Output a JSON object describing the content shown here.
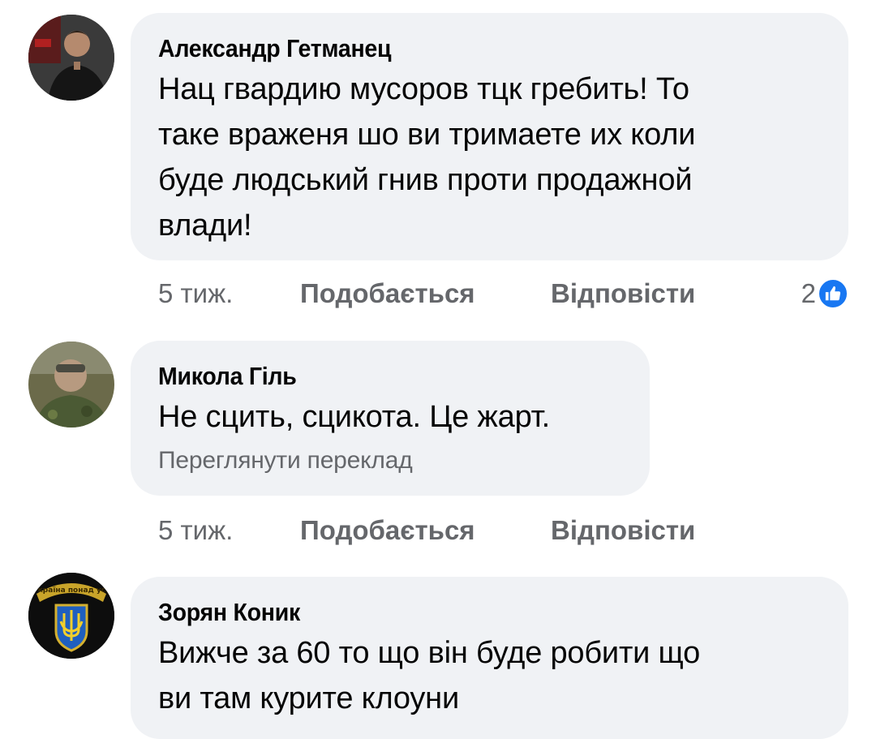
{
  "comments": [
    {
      "author": "Александр Гетманец",
      "text_lines": [
        "Нац гвардию мусоров тцк гребить! То",
        "таке враженя шо ви тримаете их коли",
        "буде людський гнив проти продажной",
        "влади!"
      ],
      "time": "5 тиж.",
      "like_label": "Подобається",
      "reply_label": "Відповісти",
      "reaction_count": "2",
      "reaction_icon": "like-icon",
      "avatar_icon": "user-photo"
    },
    {
      "author": "Микола Гіль",
      "text_lines": [
        "Не сцить, сцикота. Це жарт."
      ],
      "translate_label": "Переглянути переклад",
      "time": "5 тиж.",
      "like_label": "Подобається",
      "reply_label": "Відповісти",
      "avatar_icon": "user-photo"
    },
    {
      "author": "Зорян Коник",
      "text_lines": [
        "Вижче за 60 то що він буде робити що",
        "ви там курите клоуни"
      ],
      "avatar_icon": "trident-emblem",
      "avatar_caption": "Україна понад усе"
    }
  ],
  "colors": {
    "bubble": "#f0f2f5",
    "secondary_text": "#65676b",
    "like_blue": "#1877f2"
  }
}
